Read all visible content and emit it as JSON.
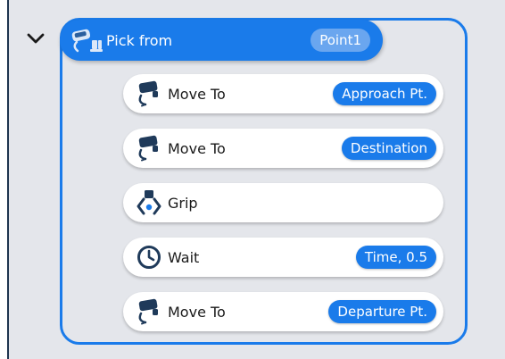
{
  "group": {
    "title": "Pick from",
    "target": "Point1",
    "icon": "robot-arm-pick-icon",
    "expanded": true
  },
  "steps": [
    {
      "label": "Move To",
      "badge": "Approach Pt.",
      "icon": "robot-arm-move-icon"
    },
    {
      "label": "Move To",
      "badge": "Destination",
      "icon": "robot-arm-move-icon"
    },
    {
      "label": "Grip",
      "badge": "",
      "icon": "gripper-icon"
    },
    {
      "label": "Wait",
      "badge": "Time, 0.5",
      "icon": "clock-icon"
    },
    {
      "label": "Move To",
      "badge": "Departure Pt.",
      "icon": "robot-arm-move-icon"
    }
  ],
  "colors": {
    "accent": "#1a7bea",
    "badge_light": "#6aa6ef",
    "panel_bg": "#e4e6eb",
    "icon_dark": "#1f3a5a"
  }
}
